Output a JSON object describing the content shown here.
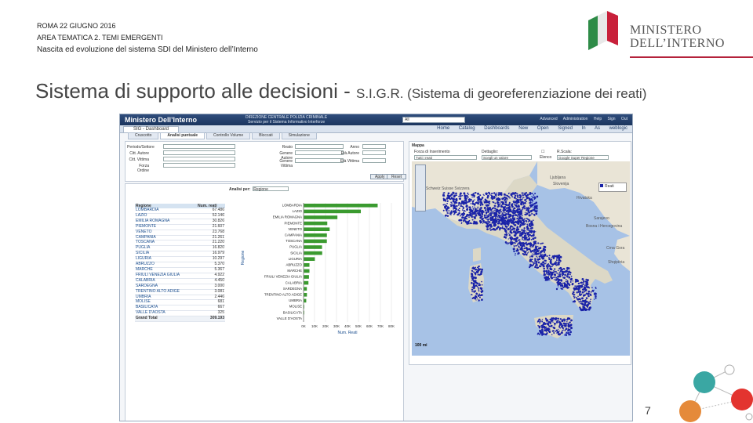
{
  "header": {
    "line1": "ROMA 22 GIUGNO 2016",
    "line2": "AREA TEMATICA 2. TEMI EMERGENTI",
    "line3": "Nascita ed evoluzione del sistema SDI del Ministero dell’Interno"
  },
  "logo": {
    "line1": "MINISTERO",
    "line2": "DELL’INTERNO"
  },
  "slide": {
    "title_main": "Sistema di supporto alle decisioni - ",
    "title_sub": "S.I.G.R. (Sistema di georeferenziazione dei reati)",
    "page_number": "7"
  },
  "app": {
    "brand": "Ministero Dell’Interno",
    "banner_line1": "DIREZIONE CENTRALE POLIZIA CRIMINALE",
    "banner_line2": "Servizio per il Sistema Informativo Interforze",
    "search_label": "Search",
    "search_value": "All",
    "top_links": [
      "Advanced",
      "Administration",
      "Help",
      "Sign Out"
    ],
    "dashboard_tab": "SIG - Dashboard",
    "menu_items": [
      "Home",
      "Catalog",
      "Dashboards",
      "New",
      "Open",
      "Signed In As weblogic"
    ],
    "sub_tabs": [
      "Cruscotto",
      "Analisi puntuale",
      "Controllo Volume",
      "Bloccati",
      "Simulazione"
    ],
    "active_sub_tab": 1,
    "filters": {
      "left": [
        "Periodo/Settore",
        "Citt. Autore",
        "Citt. Vittima",
        "Forza Ordine"
      ],
      "mid": [
        "Reato",
        "Genere Autore",
        "Genere Vittima"
      ],
      "right": [
        "Anno",
        "Età Autore",
        "Età Vittima"
      ],
      "apply": "Apply",
      "reset": "Reset"
    },
    "analysis": {
      "label": "Analisi per:",
      "value": "Regione"
    },
    "table": {
      "headers": [
        "Regione",
        "Num. reati"
      ],
      "rows": [
        [
          "LOMBARDIA",
          "67.486"
        ],
        [
          "LAZIO",
          "52.146"
        ],
        [
          "EMILIA ROMAGNA",
          "30.826"
        ],
        [
          "PIEMONTE",
          "21.607"
        ],
        [
          "VENETO",
          "23.768"
        ],
        [
          "CAMPANIA",
          "21.261"
        ],
        [
          "TOSCANA",
          "21.220"
        ],
        [
          "PUGLIA",
          "16.820"
        ],
        [
          "SICILIA",
          "16.979"
        ],
        [
          "LIGURIA",
          "10.297"
        ],
        [
          "ABRUZZO",
          "5.370"
        ],
        [
          "MARCHE",
          "5.367"
        ],
        [
          "FRIULI VENEZIA GIULIA",
          "4.922"
        ],
        [
          "CALABRIA",
          "4.450"
        ],
        [
          "SARDEGNA",
          "3.000"
        ],
        [
          "TRENTINO ALTO ADIGE",
          "3.081"
        ],
        [
          "UMBRIA",
          "2.446"
        ],
        [
          "MOLISE",
          "681"
        ],
        [
          "BASILICATA",
          "667"
        ],
        [
          "VALLE D'AOSTA",
          "325"
        ]
      ],
      "total_label": "Grand Total",
      "total_value": "309.193"
    },
    "map": {
      "title": "Mappa",
      "f1_label": "Forza di Inserimento",
      "f1_value": "Tutti i reati",
      "f2_label": "Dettaglio:",
      "f2_value": "Scegli un valore",
      "f3_label": "Elenco",
      "f4_label": "R.Scala:",
      "f4_value": "Google Super Regione",
      "legend": "Reati",
      "scale": "100 mi",
      "places": [
        "Schweiz Suisse Svizzera",
        "Ljubljana",
        "Slovenija",
        "Hrvatska",
        "Sarajevo",
        "Bosna i Hercegovina",
        "Crna Gora",
        "Shqipëria"
      ],
      "dot_color": "#1a23a8"
    }
  },
  "chart_data": {
    "type": "bar",
    "orientation": "horizontal",
    "categories": [
      "LOMBARDIA",
      "LAZIO",
      "EMILIA ROMAGNA",
      "PIEMONTE",
      "VENETO",
      "CAMPANIA",
      "TOSCANA",
      "PUGLIA",
      "SICILIA",
      "LIGURIA",
      "ABRUZZO",
      "MARCHE",
      "FRIULI VENEZIA GIULIA",
      "CALABRIA",
      "SARDEGNA",
      "TRENTINO ALTO ADIGE",
      "UMBRIA",
      "MOLISE",
      "BASILICATA",
      "VALLE D'AOSTA"
    ],
    "values": [
      67486,
      52146,
      30826,
      21607,
      23768,
      21261,
      21220,
      16820,
      16979,
      10297,
      5370,
      5367,
      4922,
      4450,
      3000,
      3081,
      2446,
      681,
      667,
      325
    ],
    "xlabel": "Num. Reati",
    "ylabel": "Regione",
    "xticks": [
      "0K",
      "10K",
      "20K",
      "30K",
      "40K",
      "50K",
      "60K",
      "70K",
      "80K"
    ],
    "xlim": [
      0,
      80000
    ],
    "bar_color": "#3a9a2f"
  }
}
